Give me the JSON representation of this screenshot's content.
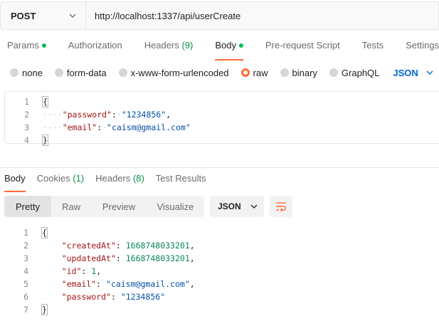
{
  "request": {
    "method": "POST",
    "url": "http://localhost:1337/api/userCreate"
  },
  "request_tabs": [
    {
      "label": "Params",
      "dot": true
    },
    {
      "label": "Authorization"
    },
    {
      "label": "Headers",
      "count": "(9)"
    },
    {
      "label": "Body",
      "dot": true,
      "active": true
    },
    {
      "label": "Pre-request Script"
    },
    {
      "label": "Tests"
    },
    {
      "label": "Settings"
    }
  ],
  "body_types": [
    "none",
    "form-data",
    "x-www-form-urlencoded",
    "raw",
    "binary",
    "GraphQL"
  ],
  "body_type_selected": "raw",
  "body_language": "JSON",
  "request_body": {
    "line_numbers": [
      "1",
      "2",
      "3",
      "4"
    ],
    "open_brace": "{",
    "close_brace": "}",
    "password_key": "\"password\"",
    "password_value": "\"1234856\"",
    "email_key": "\"email\"",
    "email_value": "\"caism@gmail.com\""
  },
  "response_tabs": [
    {
      "label": "Body",
      "active": true
    },
    {
      "label": "Cookies",
      "count": "(1)"
    },
    {
      "label": "Headers",
      "count": "(8)"
    },
    {
      "label": "Test Results"
    }
  ],
  "response_views": [
    "Pretty",
    "Raw",
    "Preview",
    "Visualize"
  ],
  "response_format": "JSON",
  "response_body": {
    "line_numbers": [
      "1",
      "2",
      "3",
      "4",
      "5",
      "6",
      "7"
    ],
    "open_brace": "{",
    "close_brace": "}",
    "created_key": "\"createdAt\"",
    "created_value": "1668748033201",
    "updated_key": "\"updatedAt\"",
    "updated_value": "1668748033201",
    "id_key": "\"id\"",
    "id_value": "1",
    "email_key": "\"email\"",
    "email_value": "\"caism@gmail.com\"",
    "password_key": "\"password\"",
    "password_value": "\"1234856\""
  },
  "colors": {
    "accent": "#ff6c37",
    "status_dot": "#0cbb52",
    "link": "#0265d2"
  },
  "icons": {
    "method_dropdown": "chevron-down-icon",
    "language_dropdown": "chevron-down-icon",
    "format_dropdown": "chevron-down-icon",
    "wrap": "wrap-lines-icon"
  }
}
